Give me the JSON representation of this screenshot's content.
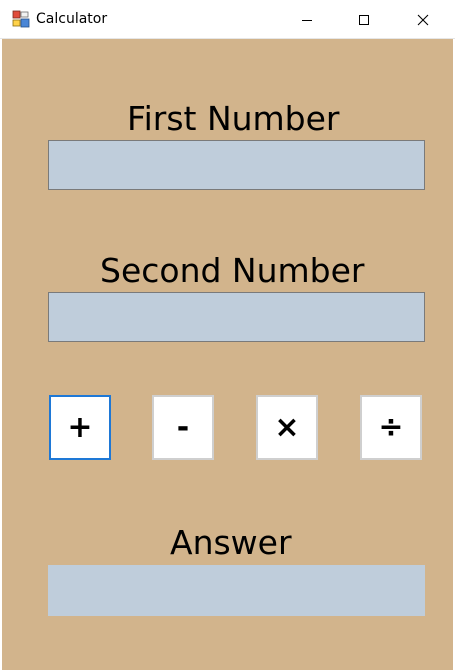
{
  "window": {
    "title": "Calculator",
    "controls": {
      "minimize_icon": "minimize-icon",
      "maximize_icon": "maximize-icon",
      "close_icon": "close-icon"
    }
  },
  "form": {
    "background_color": "#d2b48c",
    "textbox_color": "#bfcddb",
    "first_number": {
      "label": "First Number",
      "value": ""
    },
    "second_number": {
      "label": "Second Number",
      "value": ""
    },
    "operators": [
      {
        "label": "+",
        "icon": "plus-icon"
      },
      {
        "label": "-",
        "icon": "minus-icon"
      },
      {
        "label": "×",
        "icon": "multiply-icon"
      },
      {
        "label": "÷",
        "icon": "divide-icon"
      }
    ],
    "answer": {
      "label": "Answer",
      "value": ""
    }
  }
}
